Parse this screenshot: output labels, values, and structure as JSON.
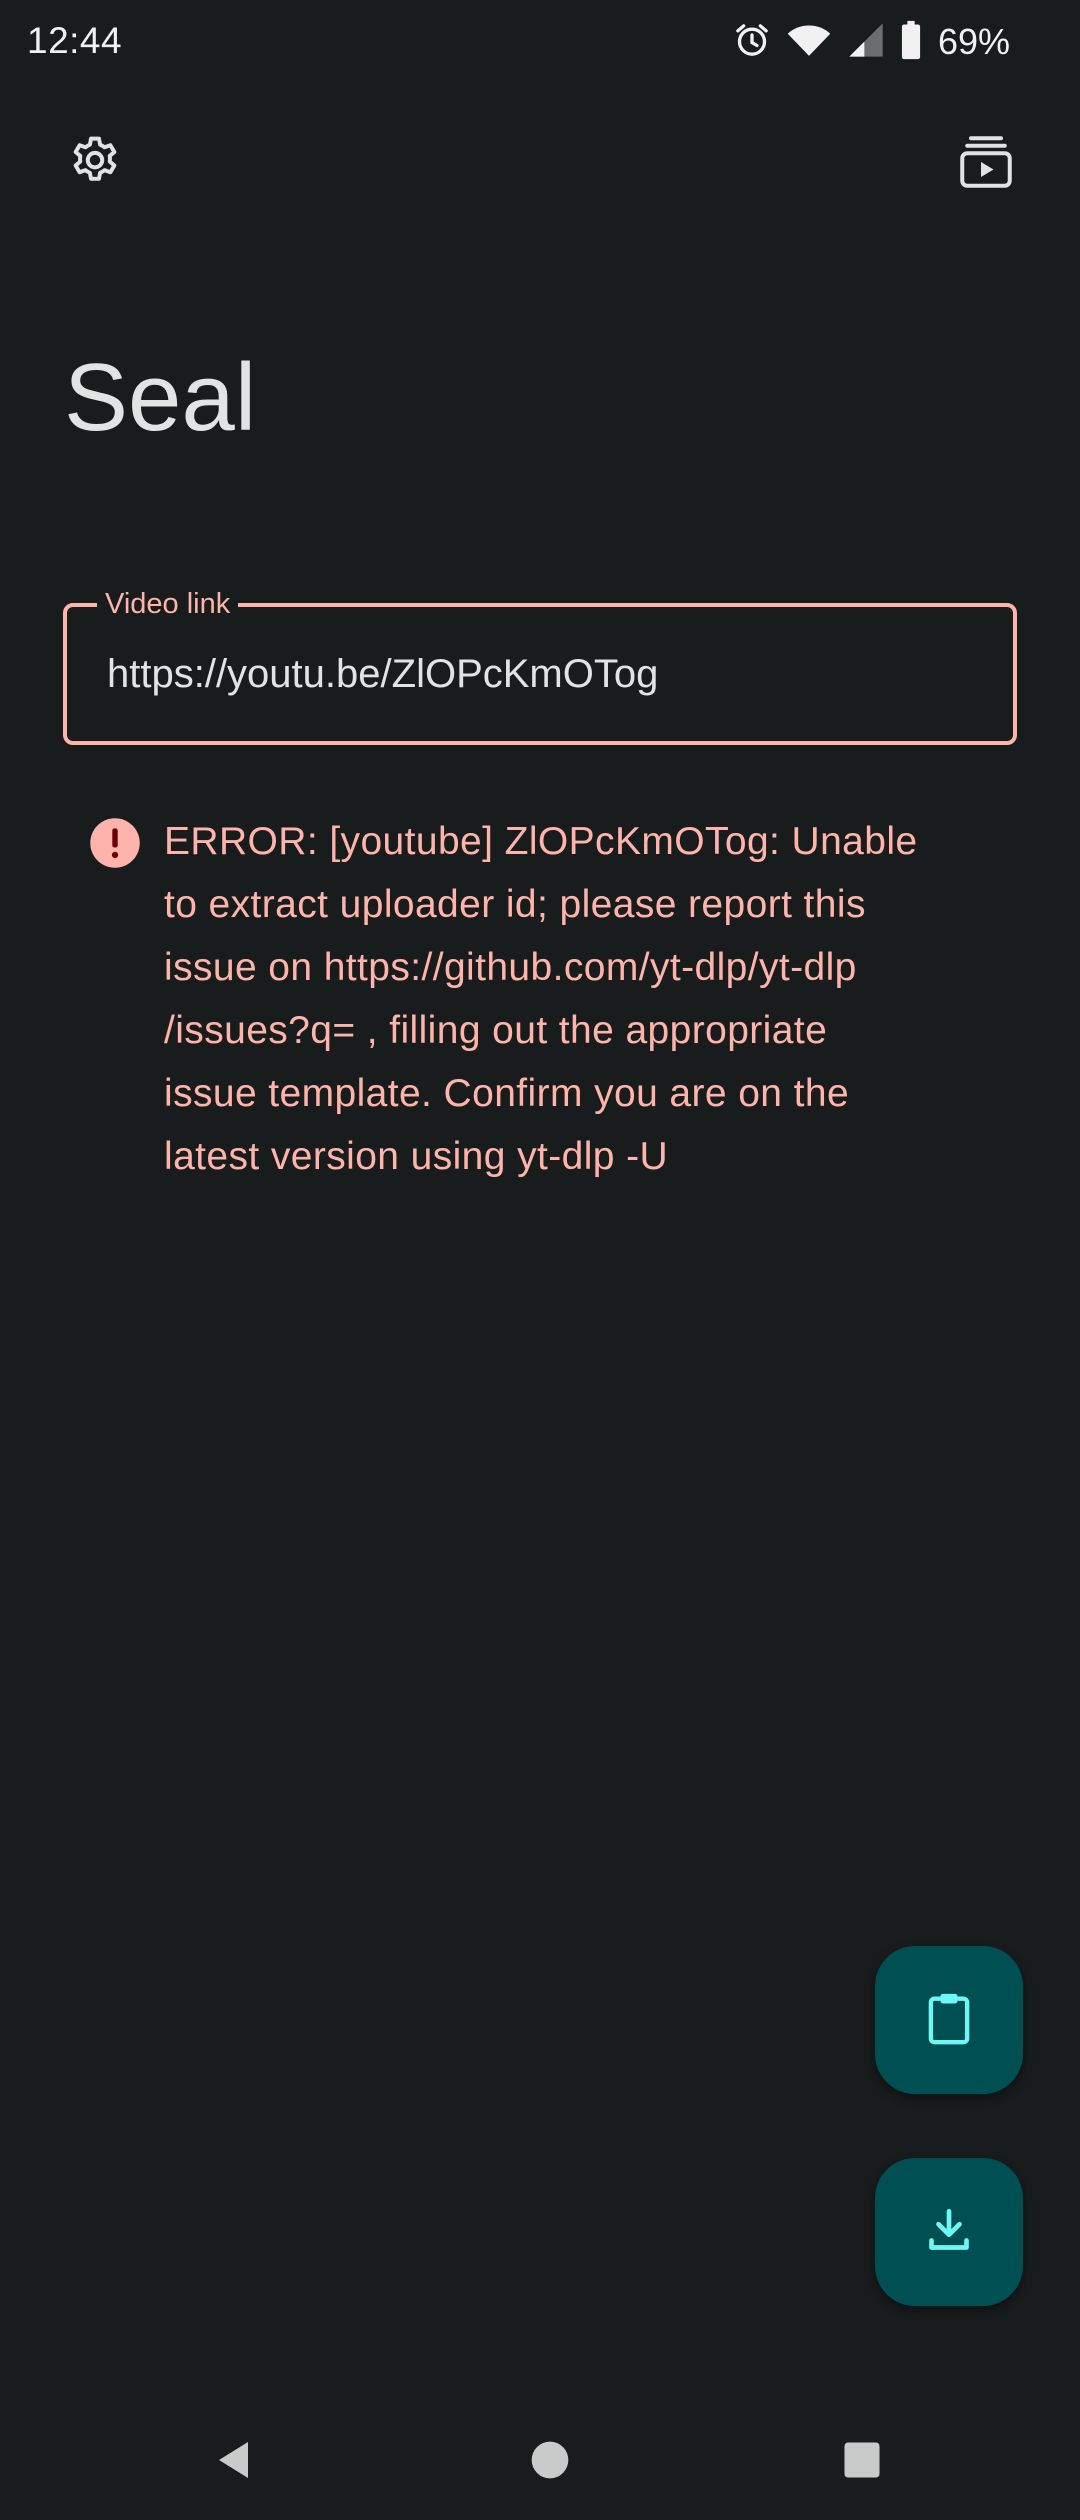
{
  "status_bar": {
    "time": "12:44",
    "battery_percent": "69%",
    "icons": [
      "alarm-icon",
      "wifi-icon",
      "signal-icon",
      "battery-icon"
    ]
  },
  "top_bar": {
    "settings_icon": "gear-icon",
    "queue_icon": "download-queue-icon"
  },
  "app": {
    "title": "Seal"
  },
  "input": {
    "label": "Video link",
    "value": "https://youtu.be/ZlOPcKmOTog"
  },
  "error": {
    "icon": "error-icon",
    "message": "ERROR: [youtube] ZlOPcKmOTog: Unable\nto extract uploader id; please report this\nissue on  https://github.com/yt-dlp/yt-dlp\n/issues?q= , filling out the appropriate\nissue template. Confirm you are on the\nlatest version using  yt-dlp -U"
  },
  "fabs": {
    "paste_icon": "clipboard-icon",
    "download_icon": "download-icon"
  },
  "nav_bar": {
    "icons": [
      "back-icon",
      "home-icon",
      "recents-icon"
    ]
  },
  "colors": {
    "background": "#191c1d",
    "error": "#ffb4ab",
    "fab_container": "#004f52",
    "fab_icon": "#6ff7f6",
    "title_text": "#e2e3e3"
  }
}
